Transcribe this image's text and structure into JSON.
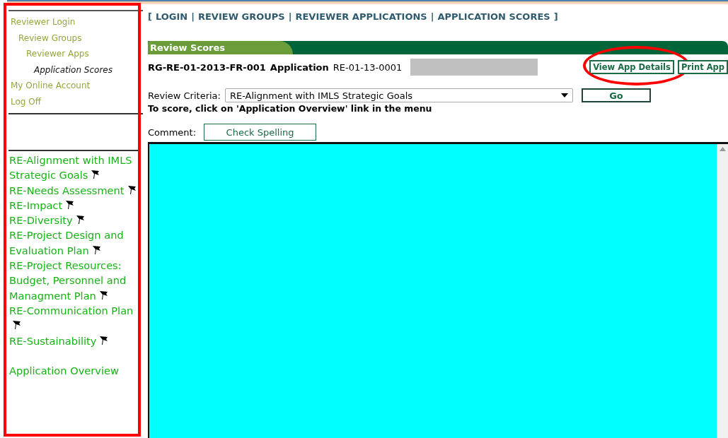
{
  "nav": [
    {
      "label": "Reviewer Login",
      "current": false,
      "children": [
        {
          "label": "Review Groups",
          "current": false,
          "children": [
            {
              "label": "Reviewer Apps",
              "current": false,
              "children": [
                {
                  "label": "Application Scores",
                  "current": true
                }
              ]
            }
          ]
        }
      ]
    },
    {
      "label": "My Online Account",
      "current": false
    },
    {
      "label": "Log Off",
      "current": false
    }
  ],
  "criteria_menu": [
    {
      "label": "RE-Alignment with IMLS Strategic Goals",
      "flag": true
    },
    {
      "label": "RE-Needs Assessment",
      "flag": true
    },
    {
      "label": "RE-Impact",
      "flag": true
    },
    {
      "label": "RE-Diversity",
      "flag": true
    },
    {
      "label": "RE-Project Design and Evaluation Plan",
      "flag": true
    },
    {
      "label": "RE-Project Resources: Budget, Personnel and Managment Plan",
      "flag": true
    },
    {
      "label": "RE-Communication Plan",
      "flag": true
    },
    {
      "label": "RE-Sustainability",
      "flag": true
    },
    {
      "label": "Application Overview",
      "flag": false
    }
  ],
  "breadcrumb": {
    "open": "[",
    "close": "]",
    "separator": "|",
    "items": [
      "LOGIN",
      "REVIEW GROUPS",
      "REVIEWER APPLICATIONS",
      "APPLICATION SCORES"
    ]
  },
  "section_tab": "Review Scores",
  "application": {
    "group_id": "RG-RE-01-2013-FR-001",
    "label": "Application",
    "number": "RE-01-13-0001"
  },
  "buttons": [
    "View App Details",
    "Print App"
  ],
  "criteria_select": {
    "label": "Review Criteria:",
    "value": "RE-Alignment with IMLS Strategic Goals",
    "button": "Go"
  },
  "instruction": "To score, click on 'Application Overview' link in the menu",
  "comment": {
    "label": "Comment:",
    "button": "Check Spelling"
  },
  "highlight_sidebar": true,
  "highlight_details_button": true
}
